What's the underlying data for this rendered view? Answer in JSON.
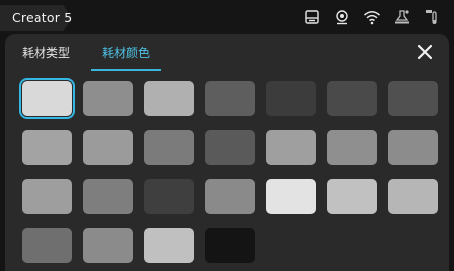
{
  "app": {
    "title": "Creator 5"
  },
  "status_icons": [
    {
      "name": "printer-status-icon"
    },
    {
      "name": "camera-icon"
    },
    {
      "name": "wifi-icon"
    },
    {
      "name": "nozzle-temperature-icon"
    },
    {
      "name": "bed-temperature-icon"
    }
  ],
  "tabs": [
    {
      "label": "耗材类型"
    },
    {
      "label": "耗材颜色"
    }
  ],
  "active_tab": 1,
  "selected_swatch": 0,
  "accent_color": "#3bb4dc",
  "swatches": [
    {
      "color": "#d9d9d9"
    },
    {
      "color": "#8e8e8e"
    },
    {
      "color": "#b0b0b0"
    },
    {
      "color": "#5e5e5e"
    },
    {
      "color": "#3c3c3c"
    },
    {
      "color": "#4a4a4a"
    },
    {
      "color": "#505050"
    },
    {
      "color": "#a3a3a3"
    },
    {
      "color": "#9b9b9b"
    },
    {
      "color": "#7b7b7b"
    },
    {
      "color": "#5a5a5a"
    },
    {
      "color": "#9f9f9f"
    },
    {
      "color": "#8f8f8f"
    },
    {
      "color": "#8c8c8c"
    },
    {
      "color": "#9e9e9e"
    },
    {
      "color": "#7e7e7e"
    },
    {
      "color": "#3f3f3f"
    },
    {
      "color": "#8a8a8a"
    },
    {
      "color": "#e3e3e3"
    },
    {
      "color": "#c1c1c1"
    },
    {
      "color": "#b6b6b6"
    },
    {
      "color": "#6f6f6f"
    },
    {
      "color": "#8b8b8b"
    },
    {
      "color": "#c0c0c0"
    },
    {
      "color": "#141414"
    }
  ]
}
